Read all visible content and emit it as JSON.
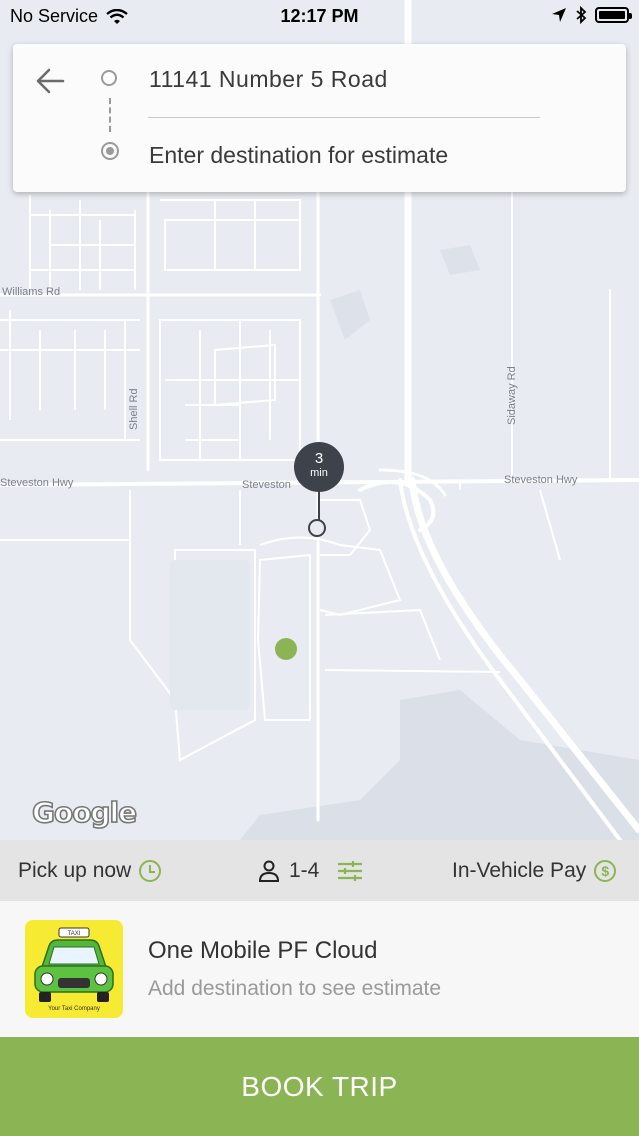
{
  "status_bar": {
    "carrier": "No Service",
    "time": "12:17 PM",
    "battery_level": 0.9
  },
  "address_card": {
    "pickup": "11141 Number 5 Road",
    "destination_placeholder": "Enter destination for estimate",
    "back_icon": "arrow-left-icon"
  },
  "map": {
    "labels": {
      "williams_rd": "Williams Rd",
      "shell_rd": "Shell Rd",
      "sidaway_rd": "Sidaway Rd",
      "steveston_hwy_left": "Steveston Hwy",
      "steveston_mid": "Steveston",
      "steveston_hwy_right": "Steveston Hwy"
    },
    "eta": {
      "value": "3",
      "unit": "min"
    },
    "attribution": "Google",
    "colors": {
      "road": "#ffffff",
      "land": "#e8ebf1",
      "water": "#d8dde7",
      "gps": "#8bb554",
      "marker": "#3e434b"
    }
  },
  "options": {
    "pickup_label": "Pick up now",
    "passengers_label": "1-4",
    "payment_label": "In-Vehicle Pay",
    "accent": "#8bb554"
  },
  "company": {
    "name": "One Mobile PF Cloud",
    "subtitle": "Add destination to see estimate",
    "logo_text": "Your Taxi Company",
    "logo_sign": "TAXI"
  },
  "book_button": {
    "label": "BOOK TRIP",
    "color": "#8bb554"
  }
}
